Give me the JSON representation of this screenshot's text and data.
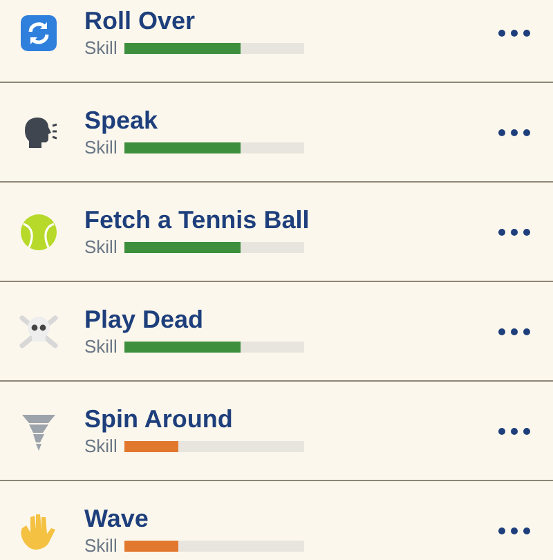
{
  "skills": [
    {
      "name": "Roll Over",
      "label": "Skill",
      "level": 0.65,
      "color": "#3d8f3d"
    },
    {
      "name": "Speak",
      "label": "Skill",
      "level": 0.65,
      "color": "#3d8f3d"
    },
    {
      "name": "Fetch a Tennis Ball",
      "label": "Skill",
      "level": 0.65,
      "color": "#3d8f3d"
    },
    {
      "name": "Play Dead",
      "label": "Skill",
      "level": 0.65,
      "color": "#3d8f3d"
    },
    {
      "name": "Spin Around",
      "label": "Skill",
      "level": 0.3,
      "color": "#e2782e"
    },
    {
      "name": "Wave",
      "label": "Skill",
      "level": 0.3,
      "color": "#e2782e"
    }
  ]
}
